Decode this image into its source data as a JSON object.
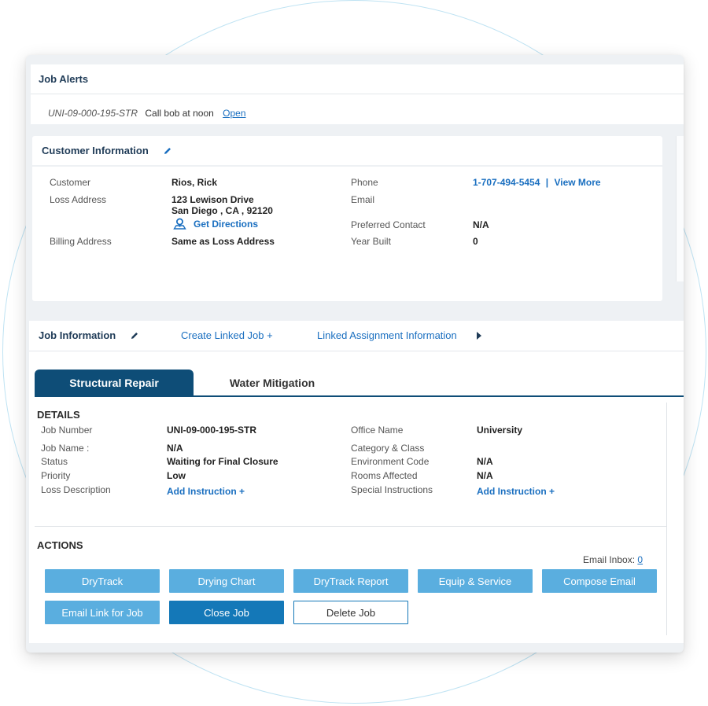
{
  "alerts": {
    "title": "Job Alerts",
    "item": {
      "code": "UNI-09-000-195-STR",
      "message": "Call bob at noon",
      "link": "Open"
    }
  },
  "customer": {
    "title": "Customer Information",
    "labels": {
      "customer": "Customer",
      "loss_address": "Loss Address",
      "billing_address": "Billing Address",
      "phone": "Phone",
      "email": "Email",
      "preferred_contact": "Preferred Contact",
      "year_built": "Year Built"
    },
    "values": {
      "customer": "Rios, Rick",
      "loss_address_line1": "123 Lewison Drive",
      "loss_address_line2": "San Diego , CA , 92120",
      "get_directions": "Get Directions",
      "billing_address": "Same as Loss Address",
      "phone": "1-707-494-5454",
      "phone_sep": "|",
      "view_more": "View More",
      "email": "",
      "preferred_contact": "N/A",
      "year_built": "0"
    }
  },
  "job": {
    "title": "Job Information",
    "create_linked": "Create Linked Job +",
    "linked_assignment": "Linked Assignment Information",
    "tabs": [
      "Structural Repair",
      "Water Mitigation"
    ],
    "details_title": "DETAILS",
    "labels": {
      "job_number": "Job Number",
      "job_name": "Job Name :",
      "status": "Status",
      "priority": "Priority",
      "loss_description": "Loss Description",
      "office_name": "Office Name",
      "category_class": "Category & Class",
      "environment_code": "Environment Code",
      "rooms_affected": "Rooms Affected",
      "special_instructions": "Special Instructions"
    },
    "values": {
      "job_number": "UNI-09-000-195-STR",
      "job_name": "N/A",
      "status": "Waiting for Final Closure",
      "priority": "Low",
      "loss_description": "Add Instruction +",
      "office_name": "University",
      "category_class": "",
      "environment_code": "N/A",
      "rooms_affected": "N/A",
      "special_instructions": "Add Instruction +"
    },
    "actions_title": "ACTIONS",
    "email_inbox_label": "Email Inbox:",
    "email_inbox_count": "0",
    "buttons": {
      "drytrack": "DryTrack",
      "drying_chart": "Drying Chart",
      "drytrack_report": "DryTrack Report",
      "equip_service": "Equip & Service",
      "compose_email": "Compose Email",
      "email_link": "Email Link for Job",
      "close_job": "Close Job",
      "delete_job": "Delete Job"
    }
  },
  "colors": {
    "accent_dark": "#0e4d77",
    "button_light": "#5aaedf",
    "button_dark": "#1478b8",
    "link": "#1a6fc0"
  }
}
